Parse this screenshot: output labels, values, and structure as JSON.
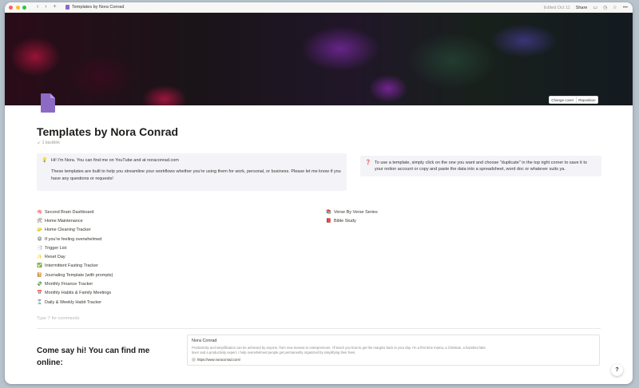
{
  "titlebar": {
    "page_title": "Templates by Nora Conrad",
    "edited": "Edited Oct 11",
    "share": "Share",
    "nav_back": "‹",
    "nav_forward": "›",
    "nav_add": "+"
  },
  "cover": {
    "change_cover": "Change cover",
    "reposition": "Reposition"
  },
  "page": {
    "title": "Templates by Nora Conrad",
    "backlink": "1 backlink"
  },
  "callouts": [
    {
      "icon": "💡",
      "paragraphs": [
        "Hi! I'm Nora. You can find me on YouTube and at noraconrad.com",
        "These templates are built to help you streamline your workflows whether you're using them for work, personal, or business. Please let me know if you have any questions or requests!"
      ]
    },
    {
      "icon": "❓",
      "paragraphs": [
        "To use a template, simply click on the one you want and choose \"duplicate\" in the top right corner to save it to your notion account or copy and paste the data into a spreadsheet, word doc or whatever suits ya."
      ]
    }
  ],
  "left_list": [
    {
      "emoji": "🧠",
      "label": "Second Brain Dashboard"
    },
    {
      "emoji": "🛠",
      "label": "Home Maintenance"
    },
    {
      "emoji": "🧽",
      "label": "Home Cleaning Tracker"
    },
    {
      "emoji": "😩",
      "label": "If you're feeling overwhelmed"
    },
    {
      "emoji": "📑",
      "label": "Trigger List"
    },
    {
      "emoji": "✨",
      "label": "Reset Day"
    },
    {
      "emoji": "✅",
      "label": "Intermittent Fasting Tracker"
    },
    {
      "emoji": "📔",
      "label": "Journaling Template (with prompts)"
    },
    {
      "emoji": "💸",
      "label": "Monthly Finance Tracker"
    },
    {
      "emoji": "📅",
      "label": "Monthly Habits & Family Meetings"
    },
    {
      "emoji": "⌛",
      "label": "Daily & Weekly Habit Tracker"
    }
  ],
  "right_list": [
    {
      "emoji": "📚",
      "label": "Verse By Verse Series"
    },
    {
      "emoji": "📕",
      "label": "Bible Study"
    }
  ],
  "command_placeholder": "Type '/' for commands",
  "footer": {
    "heading": "Come say hi! You can find me online:",
    "bookmark_title": "Nora Conrad",
    "bookmark_desc": "Productivity and simplification can be achieved by anyone, from new mamas to entrepreneurs. I'll teach you how to get the margins back in your day. I'm a first time mama, a Christian, a hazelnut latte lover and a productivity expert. I help overwhelmed people get permanently organized by simplifying their lives.",
    "bookmark_url": "https://www.noraconrad.com/"
  },
  "help_label": "?"
}
